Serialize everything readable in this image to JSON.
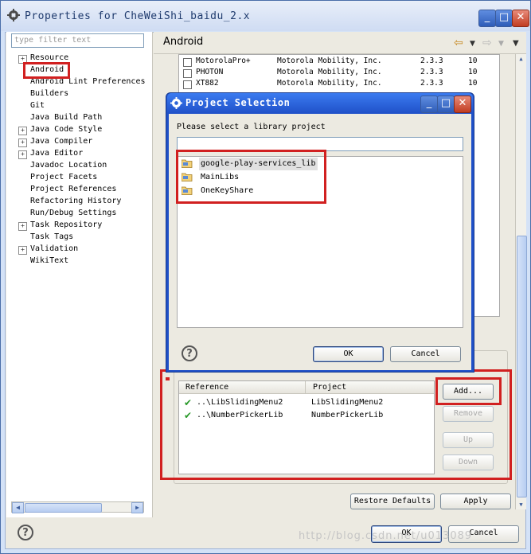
{
  "window": {
    "title": "Properties for CheWeiShi_baidu_2.x",
    "minimize": "_",
    "maximize": "□",
    "close": "✕"
  },
  "filter": {
    "placeholder": "type filter text"
  },
  "tree": [
    {
      "label": "Resource",
      "expandable": true
    },
    {
      "label": "Android",
      "expandable": false,
      "selected": true
    },
    {
      "label": "Android Lint Preferences",
      "expandable": false
    },
    {
      "label": "Builders",
      "expandable": false
    },
    {
      "label": "Git",
      "expandable": false
    },
    {
      "label": "Java Build Path",
      "expandable": false
    },
    {
      "label": "Java Code Style",
      "expandable": true
    },
    {
      "label": "Java Compiler",
      "expandable": true
    },
    {
      "label": "Java Editor",
      "expandable": true
    },
    {
      "label": "Javadoc Location",
      "expandable": false
    },
    {
      "label": "Project Facets",
      "expandable": false
    },
    {
      "label": "Project References",
      "expandable": false
    },
    {
      "label": "Refactoring History",
      "expandable": false
    },
    {
      "label": "Run/Debug Settings",
      "expandable": false
    },
    {
      "label": "Task Repository",
      "expandable": true
    },
    {
      "label": "Task Tags",
      "expandable": false
    },
    {
      "label": "Validation",
      "expandable": true
    },
    {
      "label": "WikiText",
      "expandable": false
    }
  ],
  "page": {
    "title": "Android"
  },
  "build_targets": [
    {
      "name": "MotorolaPro+",
      "vendor": "Motorola Mobility, Inc.",
      "platform": "2.3.3",
      "api": "10"
    },
    {
      "name": "PHOTON",
      "vendor": "Motorola Mobility, Inc.",
      "platform": "2.3.3",
      "api": "10"
    },
    {
      "name": "XT882",
      "vendor": "Motorola Mobility, Inc.",
      "platform": "2.3.3",
      "api": "10"
    }
  ],
  "library": {
    "columns": [
      "Reference",
      "Project"
    ],
    "rows": [
      {
        "reference": "..\\LibSlidingMenu2",
        "project": "LibSlidingMenu2"
      },
      {
        "reference": "..\\NumberPickerLib",
        "project": "NumberPickerLib"
      }
    ],
    "add": "Add...",
    "remove": "Remove",
    "up": "Up",
    "down": "Down"
  },
  "footer": {
    "restore_defaults": "Restore Defaults",
    "apply": "Apply",
    "ok": "OK",
    "cancel": "Cancel",
    "help": "?"
  },
  "dialog": {
    "title": "Project Selection",
    "prompt": "Please select a library project",
    "filter_value": "",
    "projects": [
      "google-play-services_lib",
      "MainLibs",
      "OneKeyShare"
    ],
    "ok": "OK",
    "cancel": "Cancel",
    "help": "?"
  },
  "watermark": "http://blog.csdn.net/u013089"
}
